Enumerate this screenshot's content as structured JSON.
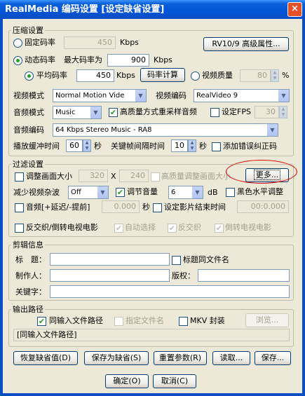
{
  "window": {
    "title": "RealMedia 编码设置 [设定缺省设置]",
    "close": "×"
  },
  "compress": {
    "legend": "压缩设置",
    "fixed": {
      "label": "固定码率",
      "value": "450",
      "unit": "Kbps"
    },
    "rv_button": "RV10/9 高级属性...",
    "dynamic": {
      "label": "动态码率",
      "max_label": "最大码率为",
      "max_value": "900",
      "unit": "Kbps"
    },
    "avg": {
      "label": "平均码率",
      "value": "450",
      "unit": "Kbps"
    },
    "calc_button": "码率计算",
    "quality": {
      "label": "视频质量",
      "value": "80",
      "unit": "%"
    },
    "video_mode": {
      "label": "视频模式",
      "value": "Normal Motion Vide"
    },
    "video_codec": {
      "label": "视频编码",
      "value": "RealVideo 9"
    },
    "audio_mode": {
      "label": "音频模式",
      "value": "Music"
    },
    "hq_resample": "高质量方式重采样音频",
    "set_fps": {
      "label": "设定FPS",
      "value": "30"
    },
    "audio_codec": {
      "label": "音频编码",
      "value": "64 Kbps Stereo Music - RA8"
    },
    "buffer": {
      "label": "播放缓冲时间",
      "value": "60",
      "unit": "秒"
    },
    "keyframe": {
      "label": "关键帧间隔时间",
      "value": "10",
      "unit": "秒"
    },
    "error_correction": "添加错误纠正码"
  },
  "filter": {
    "legend": "过滤设置",
    "resize": {
      "label": "调整画面大小",
      "w": "320",
      "x": "X",
      "h": "240"
    },
    "hq_resize": "高质量调整画面大小",
    "more_button": "更多...",
    "denoise": {
      "label": "减少视频杂波",
      "value": "Off"
    },
    "volume": {
      "label": "调节音量",
      "value": "6",
      "unit": "dB"
    },
    "black_level": "黑色水平调整",
    "audio_offset": {
      "label": "音频[+延迟/-提前]",
      "value": "0.000",
      "unit": "秒"
    },
    "end_time": {
      "label": "设定影片结束时间",
      "value": "00:0.000"
    },
    "deinterlace": "反交织/倒转电视电影",
    "auto": "自动选择",
    "interlace": "反交织",
    "telecine": "倒转电视电影"
  },
  "clip": {
    "legend": "剪辑信息",
    "title_label": "标　题：",
    "same_name": "标题同文件名",
    "author_label": "制作人：",
    "copyright_label": "版权：",
    "keywords_label": "关键字："
  },
  "output": {
    "legend": "输出路径",
    "same_path": "同输入文件路径",
    "specify": "指定文件名",
    "mkv": "MKV 封装",
    "browse": "浏览...",
    "path_value": "[同输入文件路径]"
  },
  "buttons": {
    "restore": "恢复缺省值(D)",
    "save_default": "保存为缺省(S)",
    "reset": "重置参数(R)",
    "load": "读取...",
    "save": "保存...",
    "ok": "确定(O)",
    "cancel": "取消(C)"
  },
  "colors": {
    "check_green": "#21a121",
    "title_blue": "#0454d6",
    "highlight_red": "#e00000"
  }
}
